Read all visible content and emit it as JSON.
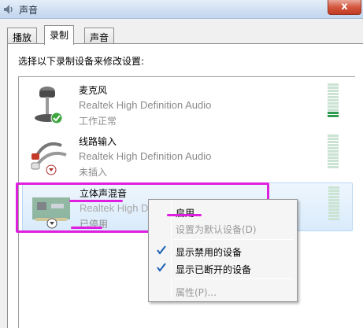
{
  "window": {
    "title": "声音",
    "close_label": "x"
  },
  "tabs": [
    {
      "label": "播放",
      "active": false
    },
    {
      "label": "录制",
      "active": true
    },
    {
      "label": "声音",
      "active": false
    }
  ],
  "instruction": "选择以下录制设备来修改设置:",
  "devices": [
    {
      "name": "麦克风",
      "description": "Realtek High Definition Audio",
      "status": "工作正常",
      "icon": "microphone-icon",
      "badge": "green-check-icon",
      "meter_level": 0.15
    },
    {
      "name": "线路输入",
      "description": "Realtek High Definition Audio",
      "status": "未插入",
      "icon": "line-in-cable-icon",
      "badge": "red-down-arrow-icon",
      "meter_level": 0
    },
    {
      "name": "立体声混音",
      "description": "Realtek High Defi",
      "status": "已停用",
      "icon": "sound-card-icon",
      "badge": "gray-down-arrow-icon",
      "meter_level": 0
    }
  ],
  "context_menu": {
    "items": [
      {
        "label": "启用",
        "enabled": true,
        "checked": false
      },
      {
        "label": "设置为默认设备(D)",
        "enabled": false,
        "checked": false
      },
      {
        "label": "显示禁用的设备",
        "enabled": true,
        "checked": true
      },
      {
        "label": "显示已断开的设备",
        "enabled": true,
        "checked": true
      },
      {
        "label": "属性(P)...",
        "enabled": false,
        "checked": false
      }
    ]
  },
  "colors": {
    "highlight": "#e01ee0",
    "meter_lit": "#2f9a52",
    "meter_dim": "#cbe3d2"
  }
}
